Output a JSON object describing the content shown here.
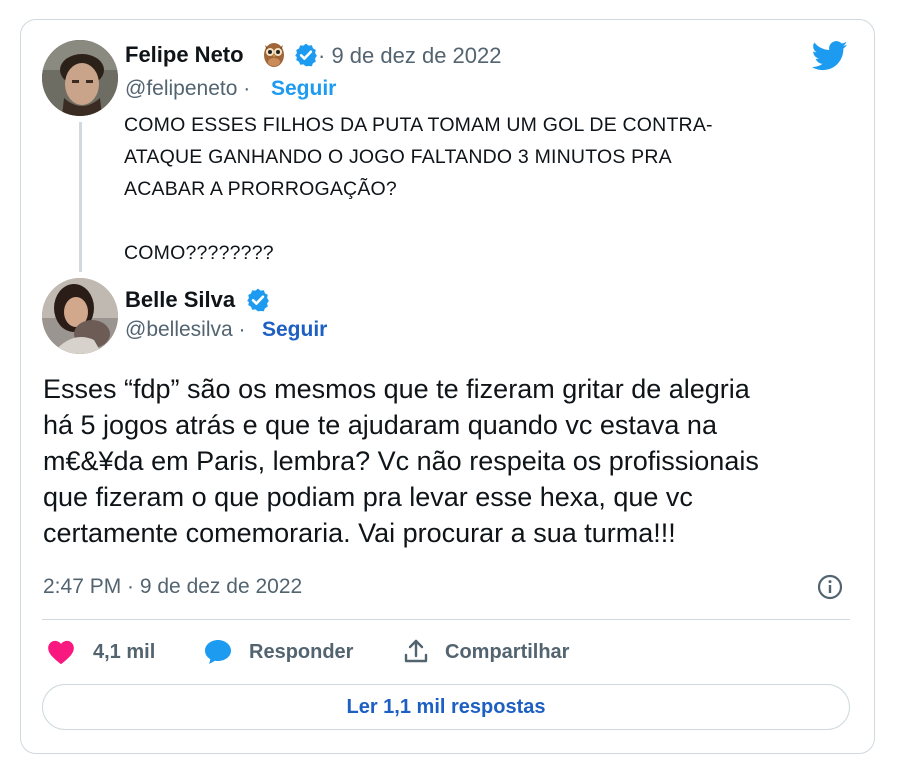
{
  "quoted_tweet": {
    "author_name": "Felipe Neto",
    "author_emoji_icon": "owl-icon",
    "date": "· 9 de dez de 2022",
    "handle": "@felipeneto ·",
    "follow_label": "Seguir",
    "text": "COMO ESSES FILHOS DA PUTA TOMAM UM GOL DE CONTRA-\nATAQUE GANHANDO O JOGO FALTANDO 3 MINUTOS PRA\nACABAR A PRORROGAÇÃO?\n\nCOMO????????"
  },
  "reply_tweet": {
    "author_name": "Belle Silva",
    "handle": "@bellesilva ·",
    "follow_label": "Seguir",
    "text": "Esses “fdp” são os mesmos que te fizeram gritar de alegria\nhá 5 jogos atrás e que te ajudaram quando vc estava na\nm€&¥da em Paris, lembra? Vc não respeita os profissionais\nque fizeram o que podiam pra levar esse hexa, que vc\ncertamente comemoraria. Vai procurar a sua turma!!!",
    "timestamp": "2:47 PM · 9 de dez de 2022"
  },
  "actions": {
    "likes": "4,1 mil",
    "reply_label": "Responder",
    "share_label": "Compartilhar",
    "read_replies_label": "Ler 1,1 mil respostas"
  },
  "colors": {
    "twitter_blue": "#1d9bf0",
    "link_blue": "#1d5fc2",
    "like_pink": "#f91880",
    "muted_text": "#536471",
    "border": "#cfd9de"
  }
}
